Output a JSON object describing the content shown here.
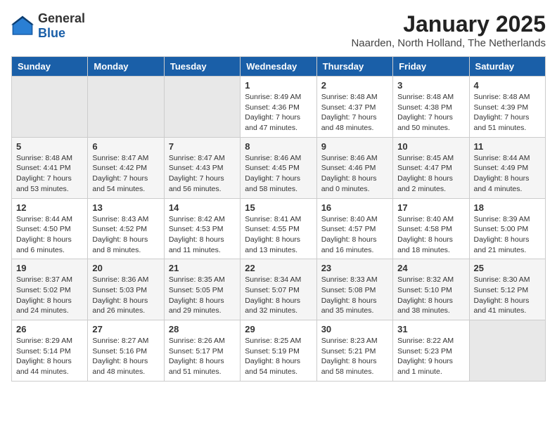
{
  "logo": {
    "general": "General",
    "blue": "Blue"
  },
  "title": "January 2025",
  "location": "Naarden, North Holland, The Netherlands",
  "weekdays": [
    "Sunday",
    "Monday",
    "Tuesday",
    "Wednesday",
    "Thursday",
    "Friday",
    "Saturday"
  ],
  "weeks": [
    [
      {
        "day": "",
        "info": ""
      },
      {
        "day": "",
        "info": ""
      },
      {
        "day": "",
        "info": ""
      },
      {
        "day": "1",
        "info": "Sunrise: 8:49 AM\nSunset: 4:36 PM\nDaylight: 7 hours\nand 47 minutes."
      },
      {
        "day": "2",
        "info": "Sunrise: 8:48 AM\nSunset: 4:37 PM\nDaylight: 7 hours\nand 48 minutes."
      },
      {
        "day": "3",
        "info": "Sunrise: 8:48 AM\nSunset: 4:38 PM\nDaylight: 7 hours\nand 50 minutes."
      },
      {
        "day": "4",
        "info": "Sunrise: 8:48 AM\nSunset: 4:39 PM\nDaylight: 7 hours\nand 51 minutes."
      }
    ],
    [
      {
        "day": "5",
        "info": "Sunrise: 8:48 AM\nSunset: 4:41 PM\nDaylight: 7 hours\nand 53 minutes."
      },
      {
        "day": "6",
        "info": "Sunrise: 8:47 AM\nSunset: 4:42 PM\nDaylight: 7 hours\nand 54 minutes."
      },
      {
        "day": "7",
        "info": "Sunrise: 8:47 AM\nSunset: 4:43 PM\nDaylight: 7 hours\nand 56 minutes."
      },
      {
        "day": "8",
        "info": "Sunrise: 8:46 AM\nSunset: 4:45 PM\nDaylight: 7 hours\nand 58 minutes."
      },
      {
        "day": "9",
        "info": "Sunrise: 8:46 AM\nSunset: 4:46 PM\nDaylight: 8 hours\nand 0 minutes."
      },
      {
        "day": "10",
        "info": "Sunrise: 8:45 AM\nSunset: 4:47 PM\nDaylight: 8 hours\nand 2 minutes."
      },
      {
        "day": "11",
        "info": "Sunrise: 8:44 AM\nSunset: 4:49 PM\nDaylight: 8 hours\nand 4 minutes."
      }
    ],
    [
      {
        "day": "12",
        "info": "Sunrise: 8:44 AM\nSunset: 4:50 PM\nDaylight: 8 hours\nand 6 minutes."
      },
      {
        "day": "13",
        "info": "Sunrise: 8:43 AM\nSunset: 4:52 PM\nDaylight: 8 hours\nand 8 minutes."
      },
      {
        "day": "14",
        "info": "Sunrise: 8:42 AM\nSunset: 4:53 PM\nDaylight: 8 hours\nand 11 minutes."
      },
      {
        "day": "15",
        "info": "Sunrise: 8:41 AM\nSunset: 4:55 PM\nDaylight: 8 hours\nand 13 minutes."
      },
      {
        "day": "16",
        "info": "Sunrise: 8:40 AM\nSunset: 4:57 PM\nDaylight: 8 hours\nand 16 minutes."
      },
      {
        "day": "17",
        "info": "Sunrise: 8:40 AM\nSunset: 4:58 PM\nDaylight: 8 hours\nand 18 minutes."
      },
      {
        "day": "18",
        "info": "Sunrise: 8:39 AM\nSunset: 5:00 PM\nDaylight: 8 hours\nand 21 minutes."
      }
    ],
    [
      {
        "day": "19",
        "info": "Sunrise: 8:37 AM\nSunset: 5:02 PM\nDaylight: 8 hours\nand 24 minutes."
      },
      {
        "day": "20",
        "info": "Sunrise: 8:36 AM\nSunset: 5:03 PM\nDaylight: 8 hours\nand 26 minutes."
      },
      {
        "day": "21",
        "info": "Sunrise: 8:35 AM\nSunset: 5:05 PM\nDaylight: 8 hours\nand 29 minutes."
      },
      {
        "day": "22",
        "info": "Sunrise: 8:34 AM\nSunset: 5:07 PM\nDaylight: 8 hours\nand 32 minutes."
      },
      {
        "day": "23",
        "info": "Sunrise: 8:33 AM\nSunset: 5:08 PM\nDaylight: 8 hours\nand 35 minutes."
      },
      {
        "day": "24",
        "info": "Sunrise: 8:32 AM\nSunset: 5:10 PM\nDaylight: 8 hours\nand 38 minutes."
      },
      {
        "day": "25",
        "info": "Sunrise: 8:30 AM\nSunset: 5:12 PM\nDaylight: 8 hours\nand 41 minutes."
      }
    ],
    [
      {
        "day": "26",
        "info": "Sunrise: 8:29 AM\nSunset: 5:14 PM\nDaylight: 8 hours\nand 44 minutes."
      },
      {
        "day": "27",
        "info": "Sunrise: 8:27 AM\nSunset: 5:16 PM\nDaylight: 8 hours\nand 48 minutes."
      },
      {
        "day": "28",
        "info": "Sunrise: 8:26 AM\nSunset: 5:17 PM\nDaylight: 8 hours\nand 51 minutes."
      },
      {
        "day": "29",
        "info": "Sunrise: 8:25 AM\nSunset: 5:19 PM\nDaylight: 8 hours\nand 54 minutes."
      },
      {
        "day": "30",
        "info": "Sunrise: 8:23 AM\nSunset: 5:21 PM\nDaylight: 8 hours\nand 58 minutes."
      },
      {
        "day": "31",
        "info": "Sunrise: 8:22 AM\nSunset: 5:23 PM\nDaylight: 9 hours\nand 1 minute."
      },
      {
        "day": "",
        "info": ""
      }
    ]
  ]
}
